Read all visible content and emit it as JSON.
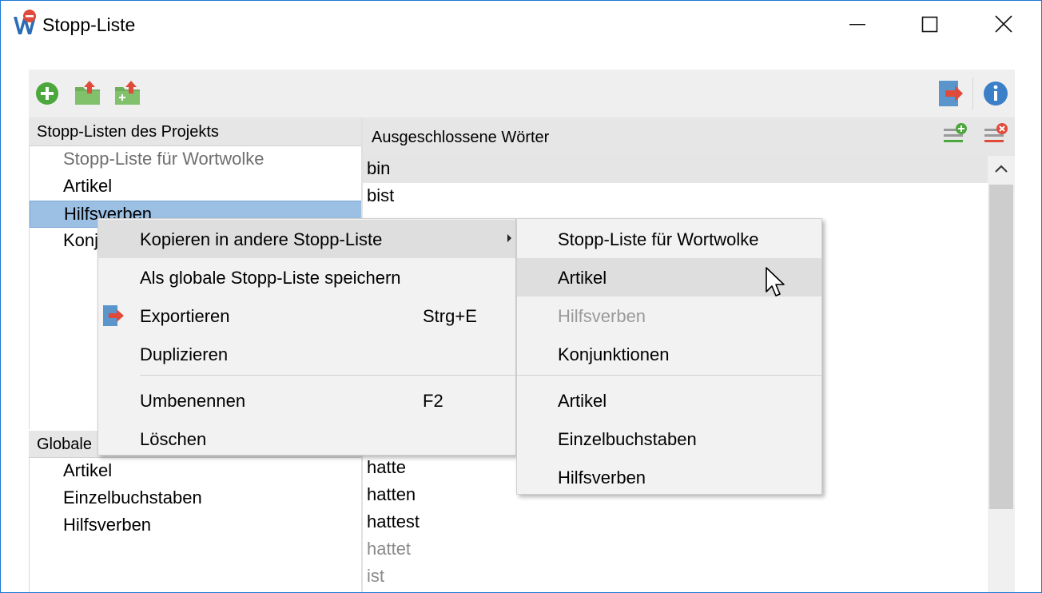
{
  "window": {
    "title": "Stopp-Liste"
  },
  "icons": {
    "app": "app-logo-icon",
    "minimize": "minimize-icon",
    "maximize": "maximize-icon",
    "close": "close-icon",
    "new_list": "add-icon",
    "import": "folder-import-icon",
    "import_add": "folder-import-add-icon",
    "export": "export-icon",
    "info": "info-icon",
    "add_word": "add-word-icon",
    "remove_word": "remove-word-icon"
  },
  "colors": {
    "accent_blue": "#1c78d6",
    "selection": "#9cc0e4",
    "green": "#4ca83c",
    "red": "#e04a3a"
  },
  "left": {
    "project_header": "Stopp-Listen des Projekts",
    "project_lists": [
      {
        "label": "Stopp-Liste für Wortwolke"
      },
      {
        "label": "Artikel"
      },
      {
        "label": "Hilfsverben"
      },
      {
        "label": "Konj"
      }
    ],
    "global_header": "Globale",
    "global_lists": [
      {
        "label": "Artikel"
      },
      {
        "label": "Einzelbuchstaben"
      },
      {
        "label": "Hilfsverben"
      }
    ]
  },
  "right": {
    "header": "Ausgeschlossene Wörter",
    "words_top": [
      "bin",
      "bist"
    ],
    "words_bottom": [
      "hatte",
      "hatten",
      "hattest",
      "hattet",
      "ist"
    ]
  },
  "context_menu": {
    "items": [
      {
        "label": "Kopieren in andere Stopp-Liste"
      },
      {
        "label": "Als globale Stopp-Liste speichern"
      },
      {
        "label": "Exportieren",
        "shortcut": "Strg+E"
      },
      {
        "label": "Duplizieren"
      },
      {
        "label": "Umbenennen",
        "shortcut": "F2"
      },
      {
        "label": "Löschen"
      }
    ]
  },
  "submenu": {
    "items": [
      {
        "label": "Stopp-Liste für Wortwolke"
      },
      {
        "label": "Artikel"
      },
      {
        "label": "Hilfsverben"
      },
      {
        "label": "Konjunktionen"
      },
      {
        "label": "Artikel"
      },
      {
        "label": "Einzelbuchstaben"
      },
      {
        "label": "Hilfsverben"
      }
    ]
  }
}
